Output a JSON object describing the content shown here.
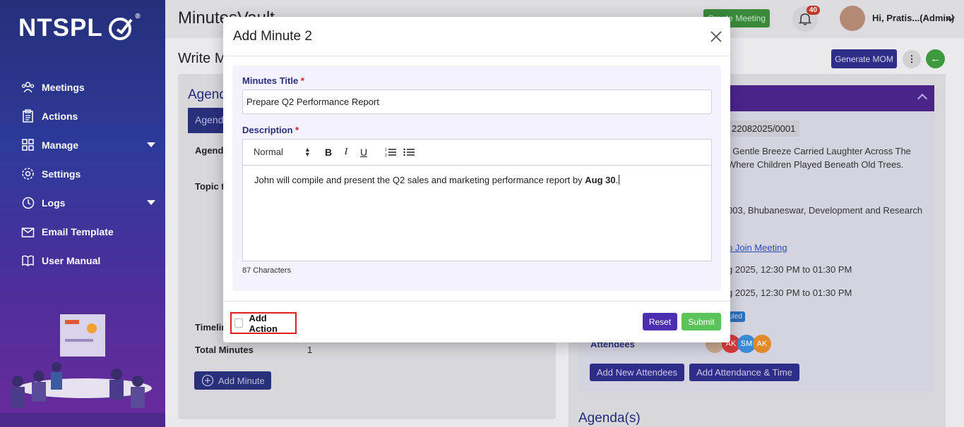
{
  "sidebar": {
    "logo": "NTSPL",
    "logo_reg": "®",
    "items": [
      {
        "label": "Meetings",
        "icon": "people-icon",
        "has_caret": false
      },
      {
        "label": "Actions",
        "icon": "clipboard-icon",
        "has_caret": false
      },
      {
        "label": "Manage",
        "icon": "grid-icon",
        "has_caret": true
      },
      {
        "label": "Settings",
        "icon": "gear-icon",
        "has_caret": false
      },
      {
        "label": "Logs",
        "icon": "history-icon",
        "has_caret": true
      },
      {
        "label": "Email Template",
        "icon": "envelope-icon",
        "has_caret": false
      },
      {
        "label": "User Manual",
        "icon": "book-icon",
        "has_caret": false
      }
    ]
  },
  "header": {
    "title": "MinutesVault",
    "create_meeting": "Create Meeting",
    "notifications": "40",
    "user": "Hi, Pratis...(Admin)"
  },
  "page": {
    "heading": "Write M",
    "generate_mom": "Generate MOM"
  },
  "left_card": {
    "title": "Agend",
    "tab": "Agenda",
    "agenda_label": "Agenda",
    "topic_label": "Topic to",
    "timeline_label": "Timelin",
    "total_minutes_label": "Total Minutes",
    "total_minutes_value": "1",
    "add_minute": "Add Minute"
  },
  "right_card": {
    "meeting_id": "22082025/0001",
    "desc_line1": ", Gentle Breeze Carried Laughter Across The",
    "desc_line2": "Where Children Played Beneath Old Trees.",
    "location": "003, Bhubaneswar, Development and Research",
    "join_link": "o Join Meeting",
    "time1": "g 2025, 12:30 PM to 01:30 PM",
    "time2": "g 2025, 12:30 PM to 01:30 PM",
    "status": "uled",
    "attendees_label": "Attendees",
    "attendees": [
      "AK",
      "SM",
      "AK"
    ],
    "add_attendees": "Add New Attendees",
    "add_attendance": "Add Attendance & Time",
    "agendas": "Agenda(s)"
  },
  "modal": {
    "title": "Add Minute 2",
    "minutes_title_label": "Minutes Title",
    "minutes_title_value": "Prepare Q2 Performance Report",
    "description_label": "Description",
    "required_mark": "*",
    "format_select": "Normal",
    "description_text": "John will compile and present the Q2 sales and marketing performance report by ",
    "description_bold": "Aug 30",
    "description_end": ".",
    "char_count": "87 Characters",
    "add_action": "Add Action",
    "reset": "Reset",
    "submit": "Submit"
  },
  "colors": {
    "primary": "#2f2d8a",
    "reset": "#4b2fb0",
    "submit": "#5cc35a",
    "required": "#d21b1b",
    "highlight": "#e0201e"
  }
}
